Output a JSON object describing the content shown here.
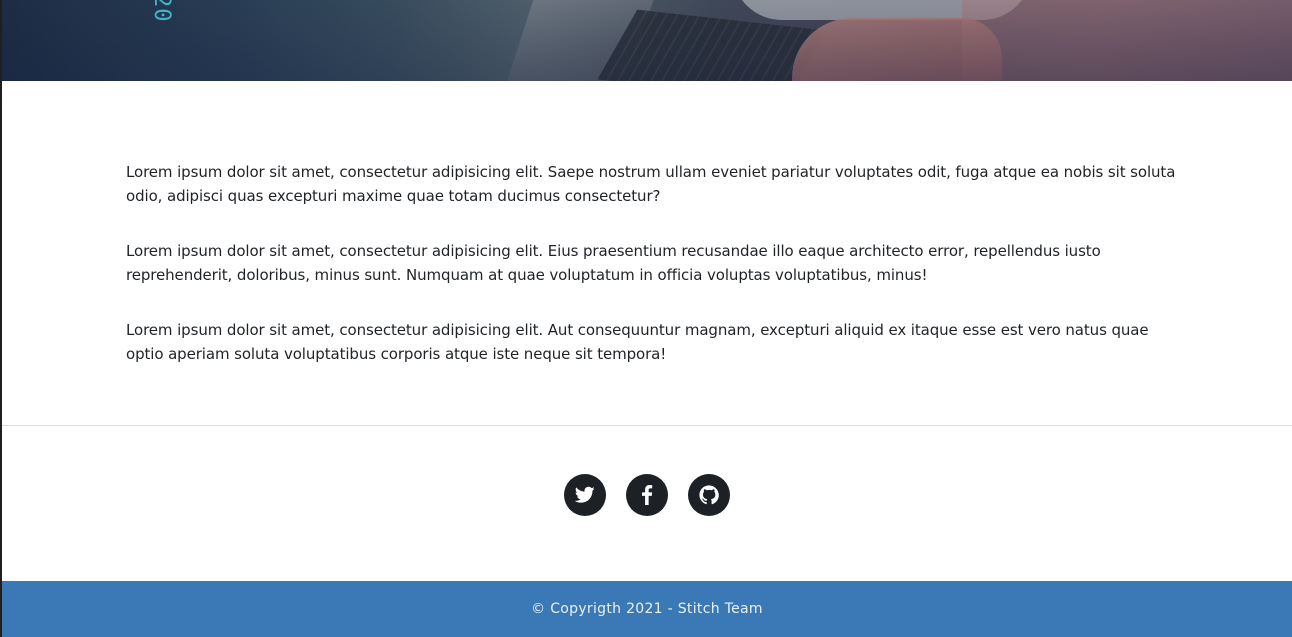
{
  "hero": {
    "image_digits": "20"
  },
  "content": {
    "paragraphs": [
      "Lorem ipsum dolor sit amet, consectetur adipisicing elit. Saepe nostrum ullam eveniet pariatur voluptates odit, fuga atque ea nobis sit soluta odio, adipisci quas excepturi maxime quae totam ducimus consectetur?",
      "Lorem ipsum dolor sit amet, consectetur adipisicing elit. Eius praesentium recusandae illo eaque architecto error, repellendus iusto reprehenderit, doloribus, minus sunt. Numquam at quae voluptatum in officia voluptas voluptatibus, minus!",
      "Lorem ipsum dolor sit amet, consectetur adipisicing elit. Aut consequuntur magnam, excepturi aliquid ex itaque esse est vero natus quae optio aperiam soluta voluptatibus corporis atque iste neque sit tempora!"
    ]
  },
  "social": {
    "items": [
      {
        "icon": "twitter-icon"
      },
      {
        "icon": "facebook-icon"
      },
      {
        "icon": "github-icon"
      }
    ]
  },
  "footer": {
    "copyright": "© Copyrigth 2021 - Stitch Team"
  },
  "colors": {
    "footer_bg": "#3b78b6",
    "social_bg": "#1d2024",
    "text": "#1f2328"
  }
}
